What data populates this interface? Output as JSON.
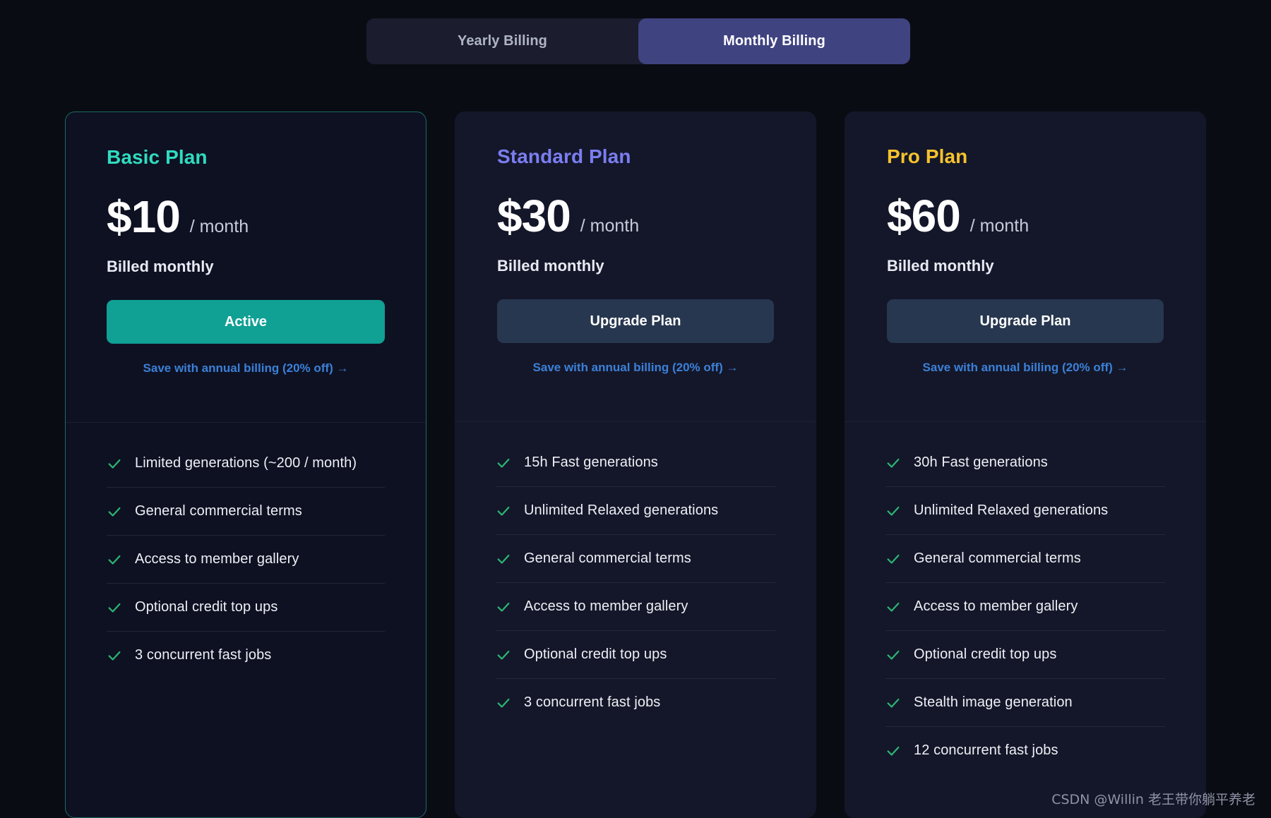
{
  "billing_toggle": {
    "yearly_label": "Yearly Billing",
    "monthly_label": "Monthly Billing",
    "selected": "Monthly Billing"
  },
  "colors": {
    "page_background": "#0a0c14",
    "basic_accent": "#2fdcc0",
    "standard_accent": "#7b7ef0",
    "pro_accent": "#f5c22e",
    "active_button": "#10a094",
    "upgrade_button": "#27374f",
    "link": "#3b80d8",
    "toggle_active": "#3f4380",
    "check": "#2bb673"
  },
  "plans": [
    {
      "name": "Basic Plan",
      "price": "$10",
      "period": "/ month",
      "billed": "Billed monthly",
      "cta_label": "Active",
      "cta_state": "active",
      "save_link": "Save with annual billing (20% off)",
      "save_link_arrow": "→",
      "features": [
        "Limited generations (~200 / month)",
        "General commercial terms",
        "Access to member gallery",
        "Optional credit top ups",
        "3 concurrent fast jobs"
      ]
    },
    {
      "name": "Standard Plan",
      "price": "$30",
      "period": "/ month",
      "billed": "Billed monthly",
      "cta_label": "Upgrade Plan",
      "cta_state": "upgrade",
      "save_link": "Save with annual billing (20% off)",
      "save_link_arrow": "→",
      "features": [
        "15h Fast generations",
        "Unlimited Relaxed generations",
        "General commercial terms",
        "Access to member gallery",
        "Optional credit top ups",
        "3 concurrent fast jobs"
      ]
    },
    {
      "name": "Pro Plan",
      "price": "$60",
      "period": "/ month",
      "billed": "Billed monthly",
      "cta_label": "Upgrade Plan",
      "cta_state": "upgrade",
      "save_link": "Save with annual billing (20% off)",
      "save_link_arrow": "→",
      "features": [
        "30h Fast generations",
        "Unlimited Relaxed generations",
        "General commercial terms",
        "Access to member gallery",
        "Optional credit top ups",
        "Stealth image generation",
        "12 concurrent fast jobs"
      ]
    }
  ],
  "watermark": "CSDN @Willin 老王带你躺平养老"
}
